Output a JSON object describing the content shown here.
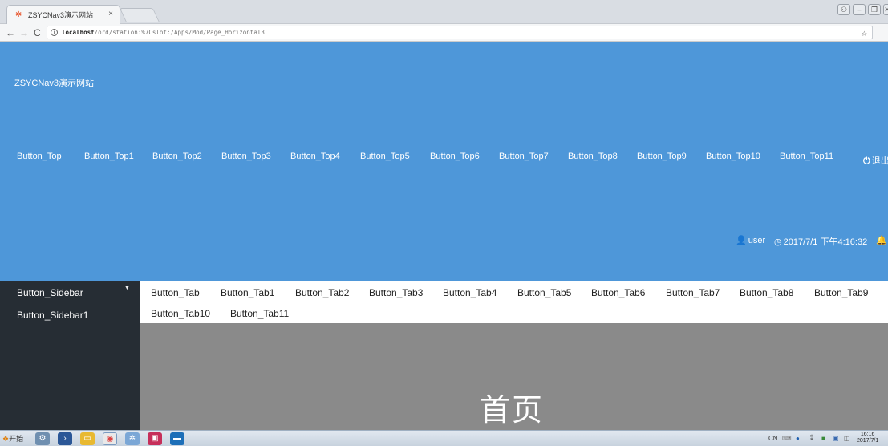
{
  "browser": {
    "tab_title": "ZSYCNav3演示网站",
    "tab_close": "×",
    "url_host": "localhost",
    "url_path": "/ord/station:%7Cslot:/Apps/Mod/Page_Horizontal3"
  },
  "header": {
    "site_title": "ZSYCNav3演示网站",
    "top_buttons": [
      "Button_Top",
      "Button_Top1",
      "Button_Top2",
      "Button_Top3",
      "Button_Top4",
      "Button_Top5",
      "Button_Top6",
      "Button_Top7",
      "Button_Top8",
      "Button_Top9",
      "Button_Top10",
      "Button_Top11"
    ],
    "logout_label": "退出",
    "user_label": "user",
    "datetime": "2017/7/1 下午4:16:32",
    "notification_count": "0"
  },
  "sidebar": {
    "items": [
      "Button_Sidebar",
      "Button_Sidebar1"
    ]
  },
  "tabs": {
    "row1": [
      "Button_Tab",
      "Button_Tab1",
      "Button_Tab2",
      "Button_Tab3",
      "Button_Tab4",
      "Button_Tab5",
      "Button_Tab6",
      "Button_Tab7",
      "Button_Tab8",
      "Button_Tab9"
    ],
    "row2": [
      "Button_Tab10",
      "Button_Tab11"
    ]
  },
  "content": {
    "heading": "首页"
  },
  "taskbar": {
    "start_label": "开始",
    "ime_label": "CN",
    "clock_time": "16:16",
    "clock_date": "2017/7/1"
  },
  "colors": {
    "header_bg": "#4e97d9",
    "sidebar_bg": "#262d34",
    "content_bg": "#8a8a8a"
  }
}
